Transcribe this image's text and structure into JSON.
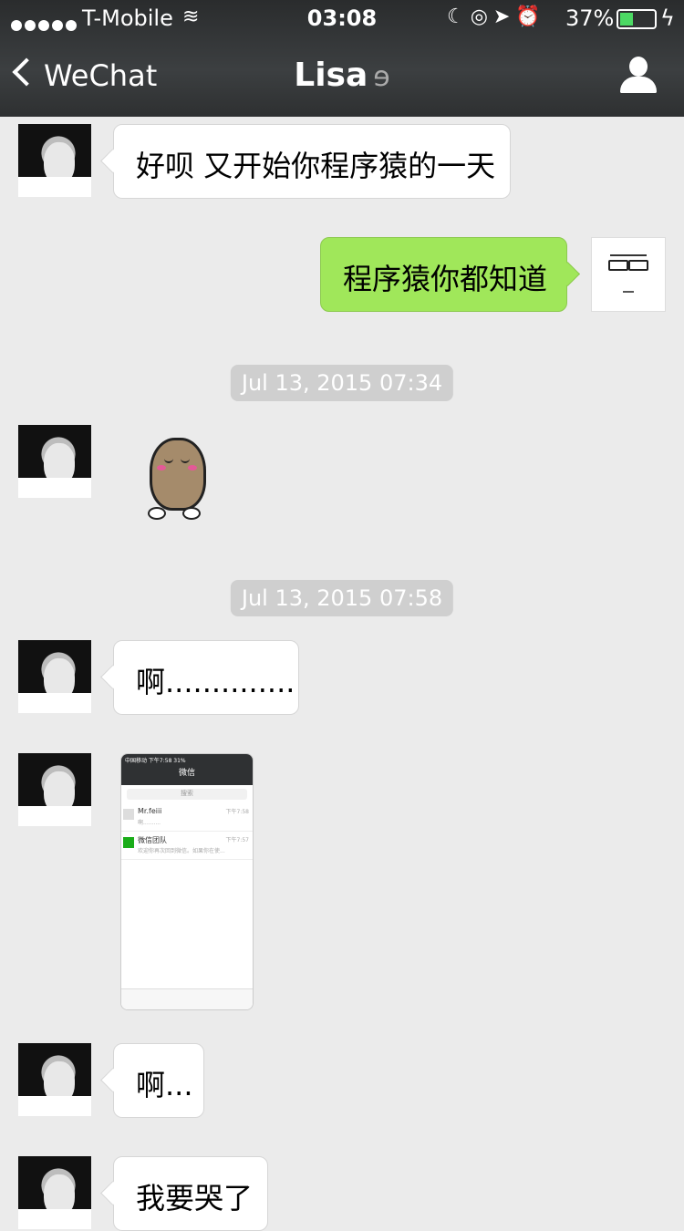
{
  "status_bar": {
    "carrier": "T-Mobile",
    "time": "03:08",
    "battery": "37%"
  },
  "nav": {
    "back_label": "WeChat",
    "title": "Lisa"
  },
  "messages": {
    "m1": "好呗 又开始你程序猿的一天",
    "m2": "程序猿你都知道",
    "ts1": "Jul 13, 2015 07:34",
    "ts2": "Jul 13, 2015 07:58",
    "m3": "啊..............",
    "m4": "啊...",
    "m5": "我要哭了"
  },
  "screenshot": {
    "status": "中国移动 下午7:58 31%",
    "title": "微信",
    "search": "搜索",
    "chat1_name": "Mr.feiii",
    "chat1_msg": "啊..........",
    "chat1_time": "下午7:58",
    "chat2_name": "微信团队",
    "chat2_msg": "欢迎你再次回到微信。如果你在使...",
    "chat2_time": "下午7:57"
  }
}
